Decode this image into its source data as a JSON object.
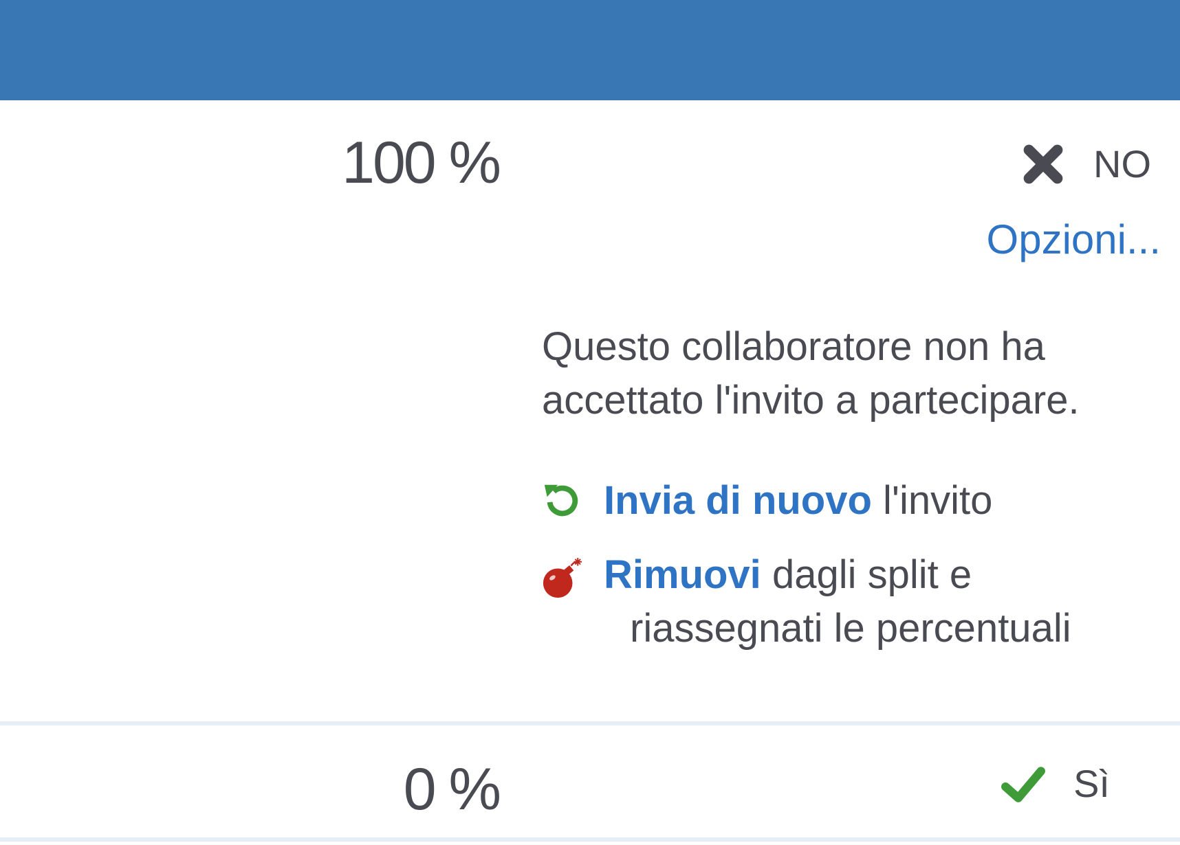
{
  "rows": [
    {
      "percent": "100 %",
      "status": {
        "icon": "x-icon",
        "label": "NO",
        "color": "#4a4a52"
      },
      "options_link": "Opzioni...",
      "message": "Questo collaboratore non ha accettato l'invito a partecipare.",
      "actions": [
        {
          "icon": "refresh-icon",
          "icon_color": "#3e9b37",
          "link": "Invia di nuovo",
          "text": "l'invito"
        },
        {
          "icon": "bomb-icon",
          "icon_color": "#c0281e",
          "link": "Rimuovi",
          "text": "dagli split e",
          "text_line2": "riassegnati le percentuali"
        }
      ]
    },
    {
      "percent": "0 %",
      "status": {
        "icon": "check-icon",
        "label": "Sì",
        "color": "#3e9b37"
      }
    }
  ],
  "colors": {
    "header": "#3877b3",
    "link": "#2f74c4",
    "text": "#4a4a52",
    "divider": "#e6eff8"
  }
}
